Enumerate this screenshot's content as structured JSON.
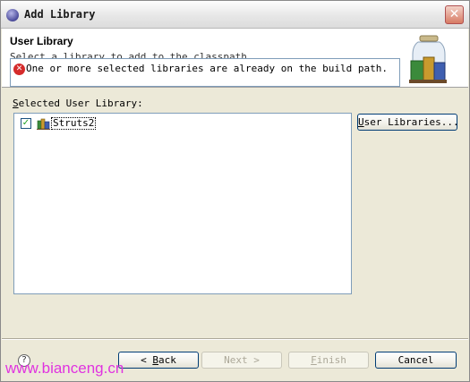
{
  "window": {
    "title": "Add Library",
    "close_glyph": "✕"
  },
  "header": {
    "title": "User Library",
    "description": "Select a library to add to the classpath",
    "error_icon": "error-icon",
    "error_glyph": "✕",
    "message": "One or more selected libraries are already on the build path."
  },
  "library_section": {
    "label_accel": "S",
    "label_rest": "elected User Library:",
    "items": [
      {
        "name": "Struts2",
        "checked": true,
        "check_glyph": "✓"
      }
    ],
    "user_libraries_accel": "U",
    "user_libraries_rest": "ser Libraries..."
  },
  "footer": {
    "help_glyph": "?",
    "back_arrow": "< ",
    "back_accel": "B",
    "back_rest": "ack",
    "next_label": "Next >",
    "finish_accel": "F",
    "finish_rest": "inish",
    "cancel_label": "Cancel"
  },
  "watermark": "www.bianceng.cn",
  "colors": {
    "error_red": "#d52b2b",
    "list_border": "#7f9db9",
    "button_border": "#003c74",
    "watermark": "#e033e0"
  }
}
